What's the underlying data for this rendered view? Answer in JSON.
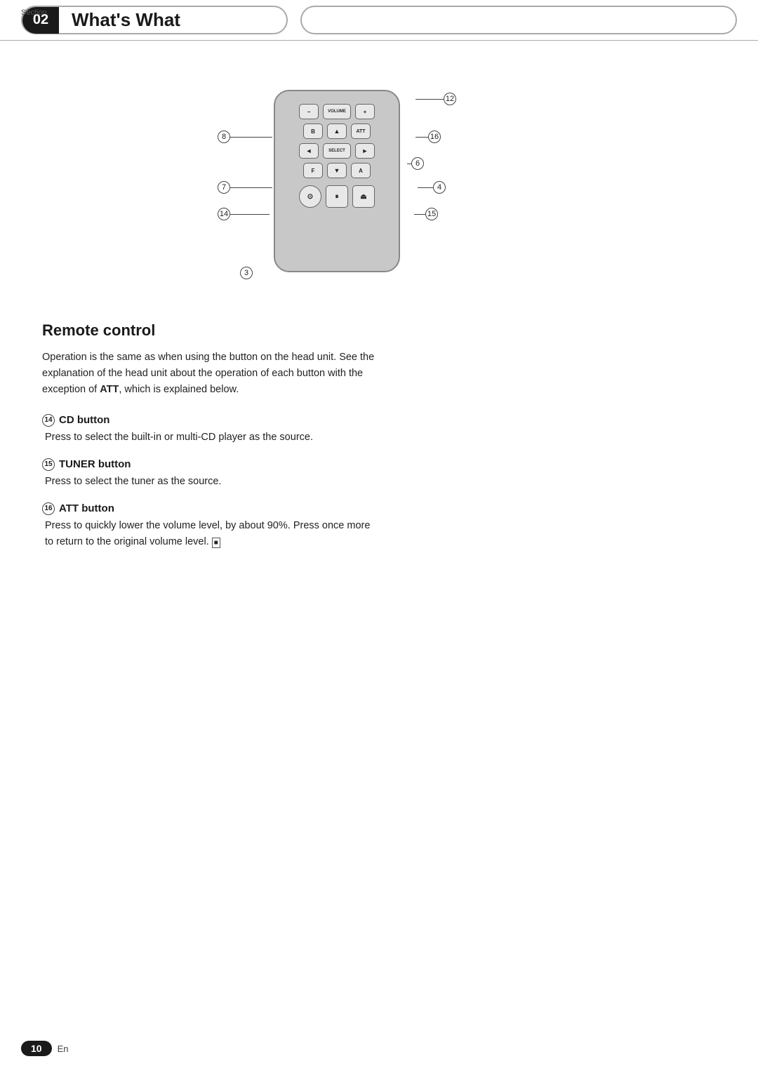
{
  "header": {
    "section_label": "Section",
    "section_number": "02",
    "title": "What's What",
    "right_label": ""
  },
  "footer": {
    "page_number": "10",
    "language": "En"
  },
  "remote": {
    "title": "Remote control",
    "intro": "Operation is the same as when using the button on the head unit. See the explanation of the head unit about the operation of each button with the exception of ATT, which is explained below.",
    "callouts": [
      {
        "id": "3",
        "label": "3"
      },
      {
        "id": "4",
        "label": "4"
      },
      {
        "id": "6",
        "label": "6"
      },
      {
        "id": "7",
        "label": "7"
      },
      {
        "id": "8",
        "label": "8"
      },
      {
        "id": "12",
        "label": "12"
      },
      {
        "id": "14",
        "label": "14"
      },
      {
        "id": "15",
        "label": "15"
      },
      {
        "id": "16",
        "label": "16"
      }
    ],
    "items": [
      {
        "id": "14",
        "heading": "CD button",
        "description": "Press to select the built-in or multi-CD player as the source."
      },
      {
        "id": "15",
        "heading": "TUNER button",
        "description": "Press to select the tuner as the source."
      },
      {
        "id": "16",
        "heading": "ATT button",
        "description": "Press to quickly lower the volume level, by about 90%. Press once more to return to the original volume level. ■"
      }
    ]
  }
}
